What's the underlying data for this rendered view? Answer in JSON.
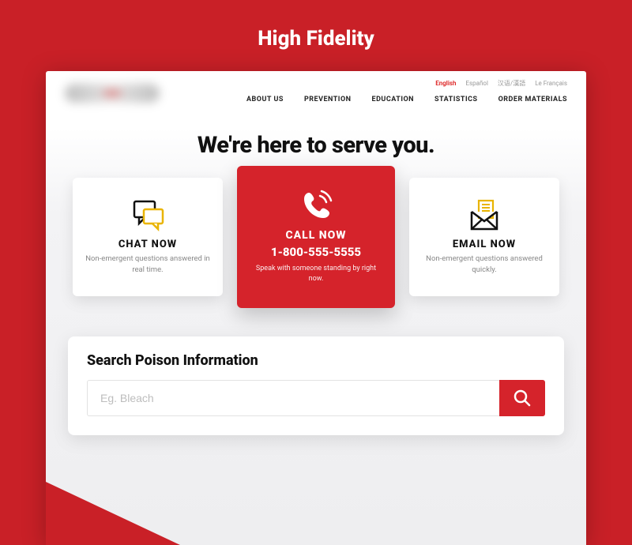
{
  "outer": {
    "title": "High Fidelity"
  },
  "lang": {
    "items": [
      "English",
      "Español",
      "汉语/漢語",
      "Le Français"
    ],
    "activeIndex": 0
  },
  "nav": {
    "items": [
      "ABOUT US",
      "PREVENTION",
      "EDUCATION",
      "STATISTICS",
      "ORDER MATERIALS"
    ]
  },
  "hero": {
    "title": "We're here to serve you."
  },
  "cards": {
    "chat": {
      "title": "CHAT NOW",
      "sub": "Non-emergent questions answered in real time."
    },
    "call": {
      "title": "CALL NOW",
      "phone": "1-800-555-5555",
      "sub": "Speak with someone standing by right now."
    },
    "email": {
      "title": "EMAIL NOW",
      "sub": "Non-emergent questions answered quickly."
    }
  },
  "search": {
    "heading": "Search Poison Information",
    "placeholder": "Eg. Bleach"
  },
  "colors": {
    "brand": "#c92027",
    "accent": "#d5232b"
  }
}
